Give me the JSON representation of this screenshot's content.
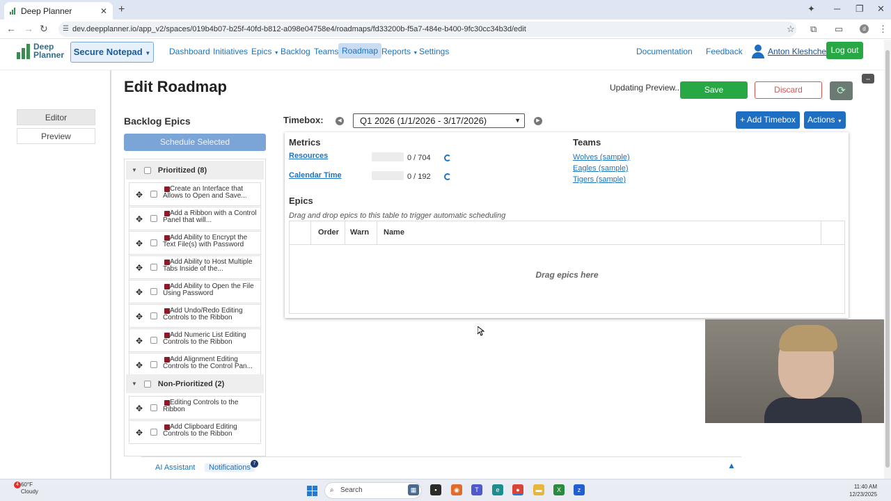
{
  "browser": {
    "tab_title": "Deep Planner",
    "url": "dev.deepplanner.io/app_v2/spaces/019b4b07-b25f-40fd-b812-a098e04758e4/roadmaps/fd33200b-f5a7-484e-b400-9fc30cc34b3d/edit"
  },
  "nav": {
    "logo_line1": "Deep",
    "logo_line2": "Planner",
    "workspace": "Secure Notepad",
    "links": [
      "Dashboard",
      "Initiatives",
      "Epics",
      "Backlog",
      "Teams",
      "Roadmap",
      "Reports",
      "Settings"
    ],
    "documentation": "Documentation",
    "feedback": "Feedback",
    "user": "Anton Kleshchev",
    "logout": "Log out"
  },
  "rail": {
    "editor": "Editor",
    "preview": "Preview"
  },
  "page": {
    "title": "Edit Roadmap",
    "status": "Updating Preview...",
    "save": "Save",
    "discard": "Discard"
  },
  "backlog": {
    "title": "Backlog Epics",
    "schedule": "Schedule Selected",
    "group1": "Prioritized (8)",
    "group2": "Non-Prioritized (2)",
    "items": [
      "Create an Interface that Allows to Open and Save...",
      "Add a Ribbon with a Control Panel that will...",
      "Add Ability to Encrypt the Text File(s) with Password",
      "Add Ability to Host Multiple Tabs Inside of the...",
      "Add Ability to Open the File Using Password",
      "Add Undo/Redo Editing Controls to the Ribbon",
      "Add Numeric List Editing Controls to the Ribbon",
      "Add Alignment Editing Controls to the Control Pan...",
      "Editing Controls to the Ribbon",
      "Add Clipboard Editing Controls to the Ribbon"
    ]
  },
  "timebox": {
    "label": "Timebox:",
    "selected": "Q1 2026 (1/1/2026 - 3/17/2026)",
    "add": "+ Add Timebox",
    "actions": "Actions"
  },
  "metrics": {
    "title": "Metrics",
    "resources_label": "Resources",
    "resources_value": "0 / 704",
    "calendar_label": "Calendar Time",
    "calendar_value": "0 / 192"
  },
  "teams": {
    "title": "Teams",
    "items": [
      "Wolves (sample)",
      "Eagles (sample)",
      "Tigers (sample)"
    ]
  },
  "epics": {
    "title": "Epics",
    "hint": "Drag and drop epics to this table to trigger automatic scheduling",
    "col_order": "Order",
    "col_warn": "Warn",
    "col_name": "Name",
    "empty": "Drag epics here"
  },
  "bottom": {
    "ai": "AI Assistant",
    "notifications": "Notifications",
    "notif_count": "7"
  },
  "taskbar": {
    "weather_badge": "4",
    "temp": "60°F",
    "condition": "Cloudy",
    "search": "Search",
    "time": "11:40 AM",
    "date": "12/23/2025"
  },
  "colors": {
    "primary": "#1e6fc2",
    "success": "#28a745",
    "danger": "#d9534f",
    "epic": "#8b1a2b"
  }
}
